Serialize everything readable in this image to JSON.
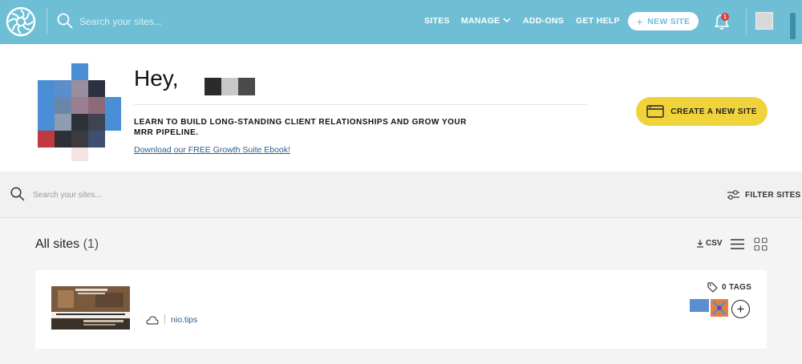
{
  "topbar": {
    "search_placeholder": "Search your sites...",
    "nav": {
      "sites": "SITES",
      "manage": "MANAGE",
      "addons": "ADD-ONS",
      "help": "GET HELP"
    },
    "new_site": "NEW SITE",
    "notification_count": "1",
    "colors": {
      "background": "#6ebfd6",
      "badge": "#e0383b"
    }
  },
  "hero": {
    "greeting": "Hey,",
    "message": "LEARN TO BUILD LONG-STANDING CLIENT RELATIONSHIPS AND GROW YOUR MRR PIPELINE.",
    "link": "Download our FREE Growth Suite Ebook!",
    "create_button": "CREATE A NEW SITE",
    "colors": {
      "button": "#f0d33b"
    }
  },
  "filter": {
    "search_placeholder": "Search your sites...",
    "filter_label": "FILTER SITES"
  },
  "list": {
    "title": "All sites",
    "count": "(1)",
    "csv_label": "CSV",
    "sites": [
      {
        "domain": "nio.tips",
        "tags_label": "0 TAGS"
      }
    ]
  }
}
